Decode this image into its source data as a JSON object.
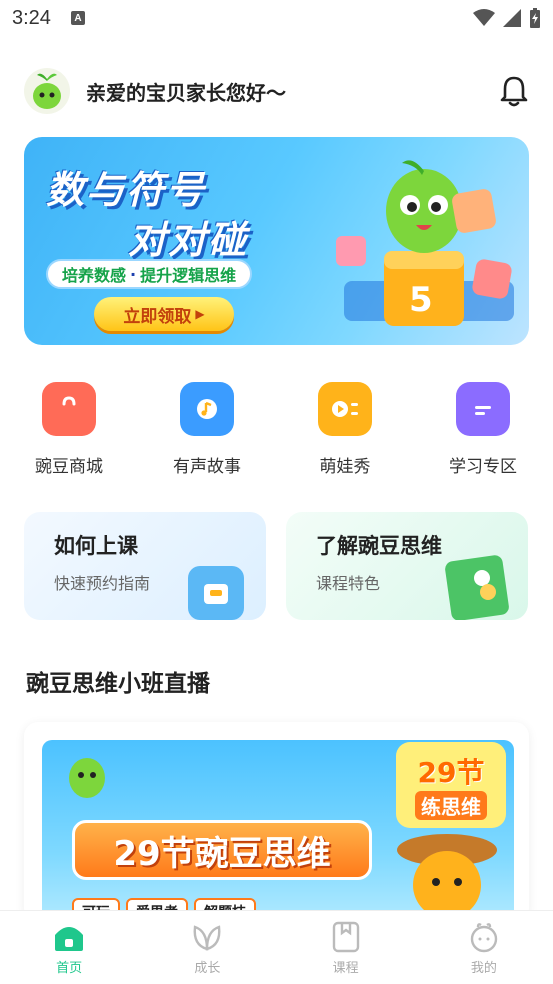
{
  "status_bar": {
    "time": "3:24",
    "notification_badge": "A"
  },
  "header": {
    "greeting": "亲爱的宝贝家长您好～"
  },
  "banner": {
    "title_line1": "数与符号",
    "title_line2": "对对碰",
    "tagline_part1": "培养数感",
    "tagline_sep": "·",
    "tagline_part2": "提升逻辑思维",
    "cta": "立即领取",
    "dice_digit": "5"
  },
  "quick_links": [
    {
      "label": "豌豆商城",
      "icon": "shopping-bag-icon",
      "color": "#ff6b57"
    },
    {
      "label": "有声故事",
      "icon": "music-icon",
      "color": "#3b9cff"
    },
    {
      "label": "萌娃秀",
      "icon": "video-icon",
      "color": "#ffb31a"
    },
    {
      "label": "学习专区",
      "icon": "book-icon",
      "color": "#8b6cff"
    }
  ],
  "cards": [
    {
      "title": "如何上课",
      "subtitle": "快速预约指南"
    },
    {
      "title": "了解豌豆思维",
      "subtitle": "课程特色"
    }
  ],
  "section": {
    "title": "豌豆思维小班直播"
  },
  "live_banner": {
    "main_title": "29节豌豆思维",
    "badge_top": "29节",
    "badge_bottom": "练思维",
    "tags": [
      "可玩",
      "爱思考",
      "解题技"
    ]
  },
  "tab_bar": [
    {
      "label": "首页",
      "icon": "home-icon",
      "active": true
    },
    {
      "label": "成长",
      "icon": "leaf-icon",
      "active": false
    },
    {
      "label": "课程",
      "icon": "course-book-icon",
      "active": false
    },
    {
      "label": "我的",
      "icon": "profile-icon",
      "active": false
    }
  ],
  "colors": {
    "accent": "#1fc78c",
    "inactive": "#aaaaaa"
  }
}
